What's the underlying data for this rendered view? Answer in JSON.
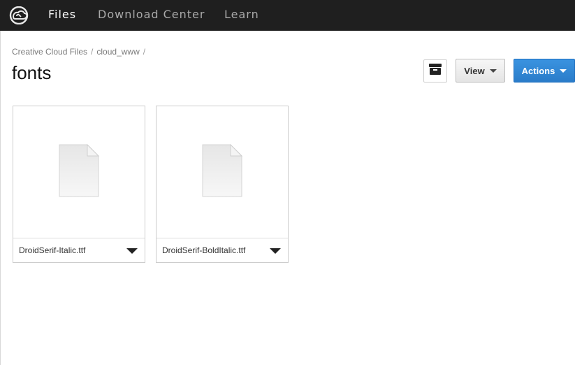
{
  "topbar": {
    "logo_icon": "creative-cloud-logo-icon",
    "nav": [
      {
        "label": "Files",
        "active": true
      },
      {
        "label": "Download Center",
        "active": false
      },
      {
        "label": "Learn",
        "active": false
      }
    ]
  },
  "breadcrumb": {
    "items": [
      "Creative Cloud Files",
      "cloud_www"
    ],
    "separator": "/"
  },
  "page": {
    "title": "fonts"
  },
  "toolbar": {
    "archive_icon": "archive-icon",
    "view_label": "View",
    "actions_label": "Actions"
  },
  "files": [
    {
      "name": "DroidSerif-Italic.ttf",
      "icon": "file-icon"
    },
    {
      "name": "DroidSerif-BoldItalic.ttf",
      "icon": "file-icon"
    }
  ],
  "colors": {
    "topbar_bg": "#1f1f1f",
    "accent_blue": "#2a7cc9",
    "nav_active": "#ffffff",
    "nav_inactive": "#a9a9a9"
  }
}
